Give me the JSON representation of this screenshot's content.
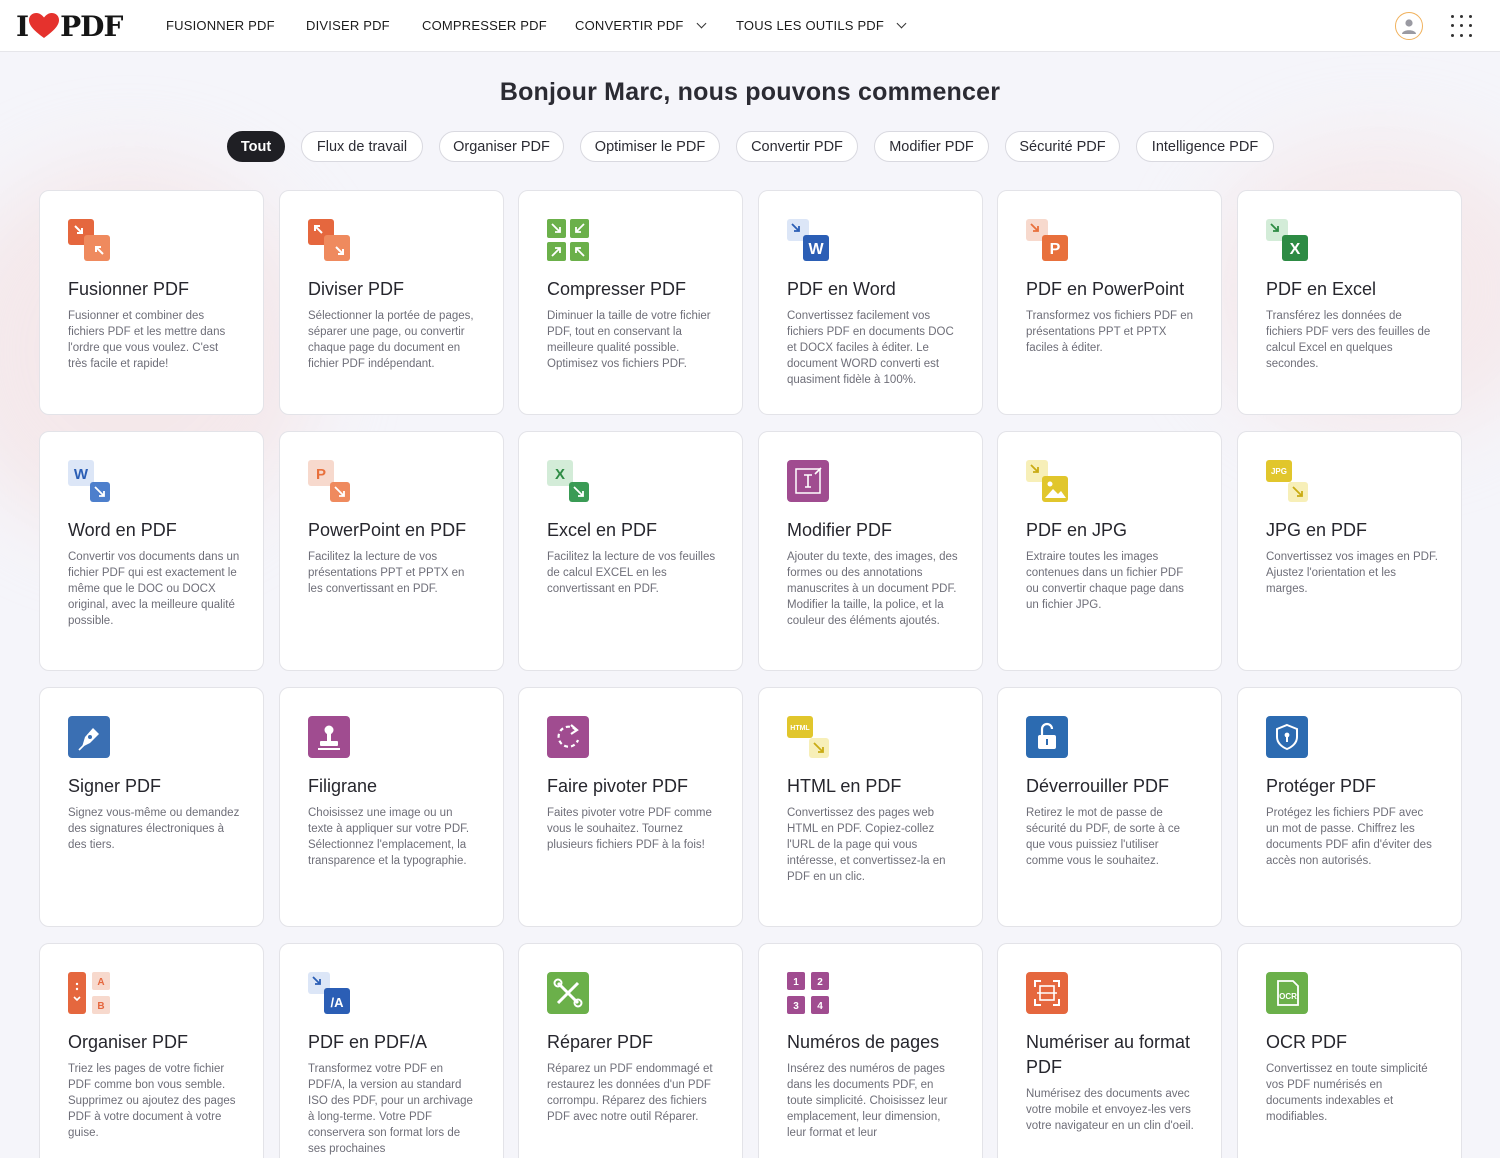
{
  "nav": {
    "logo_left": "I",
    "logo_right": "PDF",
    "items": [
      {
        "label": "FUSIONNER PDF"
      },
      {
        "label": "DIVISER PDF"
      },
      {
        "label": "COMPRESSER PDF"
      },
      {
        "label": "CONVERTIR PDF"
      },
      {
        "label": "TOUS LES OUTILS PDF"
      }
    ]
  },
  "greeting": "Bonjour Marc, nous pouvons commencer",
  "filters": [
    {
      "label": "Tout",
      "active": true
    },
    {
      "label": "Flux de travail"
    },
    {
      "label": "Organiser PDF"
    },
    {
      "label": "Optimiser le PDF"
    },
    {
      "label": "Convertir PDF"
    },
    {
      "label": "Modifier PDF"
    },
    {
      "label": "Sécurité PDF"
    },
    {
      "label": "Intelligence PDF"
    }
  ],
  "colors": {
    "brand_red": "#e5322d",
    "organize": "#e5673e",
    "optimize": "#6bb04a",
    "word": "#2b5eb5",
    "powerpoint": "#e8703c",
    "excel": "#2d8b44",
    "edit": "#a04c90",
    "jpg": "#e1c62c",
    "security": "#2c6bb1",
    "sign": "#3a6fb3"
  },
  "tools": [
    {
      "title": "Fusionner PDF",
      "icon": "merge-icon",
      "desc": "Fusionner et combiner des fichiers PDF et les mettre dans l'ordre que vous voulez. C'est très facile et rapide!"
    },
    {
      "title": "Diviser PDF",
      "icon": "split-icon",
      "desc": "Sélectionner la portée de pages, séparer une page, ou convertir chaque page du document en fichier PDF indépendant."
    },
    {
      "title": "Compresser PDF",
      "icon": "compress-icon",
      "desc": "Diminuer la taille de votre fichier PDF, tout en conservant la meilleure qualité possible. Optimisez vos fichiers PDF."
    },
    {
      "title": "PDF en Word",
      "icon": "pdf-to-word-icon",
      "desc": "Convertissez facilement vos fichiers PDF en documents DOC et DOCX faciles à éditer. Le document WORD converti est quasiment fidèle à 100%.",
      "badge": "W"
    },
    {
      "title": "PDF en PowerPoint",
      "icon": "pdf-to-powerpoint-icon",
      "desc": "Transformez vos fichiers PDF en présentations PPT et PPTX faciles à éditer.",
      "badge": "P"
    },
    {
      "title": "PDF en Excel",
      "icon": "pdf-to-excel-icon",
      "desc": "Transférez les données de fichiers PDF vers des feuilles de calcul Excel en quelques secondes.",
      "badge": "X"
    },
    {
      "title": "Word en PDF",
      "icon": "word-to-pdf-icon",
      "desc": "Convertir vos documents dans un fichier PDF qui est exactement le même que le DOC ou DOCX original, avec la meilleure qualité possible.",
      "badge": "W"
    },
    {
      "title": "PowerPoint en PDF",
      "icon": "powerpoint-to-pdf-icon",
      "desc": "Facilitez la lecture de vos présentations PPT et PPTX en les convertissant en PDF.",
      "badge": "P"
    },
    {
      "title": "Excel en PDF",
      "icon": "excel-to-pdf-icon",
      "desc": "Facilitez la lecture de vos feuilles de calcul EXCEL en les convertissant en PDF.",
      "badge": "X"
    },
    {
      "title": "Modifier PDF",
      "icon": "edit-pdf-icon",
      "desc": "Ajouter du texte, des images, des formes ou des annotations manuscrites à un document PDF. Modifier la taille, la police, et la couleur des éléments ajoutés."
    },
    {
      "title": "PDF en JPG",
      "icon": "pdf-to-jpg-icon",
      "desc": "Extraire toutes les images contenues dans un fichier PDF ou convertir chaque page dans un fichier JPG."
    },
    {
      "title": "JPG en PDF",
      "icon": "jpg-to-pdf-icon",
      "desc": "Convertissez vos images en PDF. Ajustez l'orientation et les marges.",
      "badge": "JPG"
    },
    {
      "title": "Signer PDF",
      "icon": "sign-pdf-icon",
      "desc": "Signez vous-même ou demandez des signatures électroniques à des tiers."
    },
    {
      "title": "Filigrane",
      "icon": "watermark-icon",
      "desc": "Choisissez une image ou un texte à appliquer sur votre PDF. Sélectionnez l'emplacement, la transparence et la typographie."
    },
    {
      "title": "Faire pivoter PDF",
      "icon": "rotate-pdf-icon",
      "desc": "Faites pivoter votre PDF comme vous le souhaitez. Tournez plusieurs fichiers PDF à la fois!"
    },
    {
      "title": "HTML en PDF",
      "icon": "html-to-pdf-icon",
      "desc": "Convertissez des pages web HTML en PDF. Copiez-collez l'URL de la page qui vous intéresse, et convertissez-la en PDF en un clic.",
      "badge": "HTML"
    },
    {
      "title": "Déverrouiller PDF",
      "icon": "unlock-pdf-icon",
      "desc": "Retirez le mot de passe de sécurité du PDF, de sorte à ce que vous puissiez l'utiliser comme vous le souhaitez."
    },
    {
      "title": "Protéger PDF",
      "icon": "protect-pdf-icon",
      "desc": "Protégez les fichiers PDF avec un mot de passe. Chiffrez les documents PDF afin d'éviter des accès non autorisés."
    },
    {
      "title": "Organiser PDF",
      "icon": "organize-pdf-icon",
      "desc": "Triez les pages de votre fichier PDF comme bon vous semble. Supprimez ou ajoutez des pages PDF à votre document à votre guise.",
      "badge_a": "A",
      "badge_b": "B"
    },
    {
      "title": "PDF en PDF/A",
      "icon": "pdf-to-pdfa-icon",
      "desc": "Transformez votre PDF en PDF/A, la version au standard ISO des PDF, pour un archivage à long-terme. Votre PDF conservera son format lors de ses prochaines",
      "badge": "/A"
    },
    {
      "title": "Réparer PDF",
      "icon": "repair-pdf-icon",
      "desc": "Réparez un PDF endommagé et restaurez les données d'un PDF corrompu. Réparez des fichiers PDF avec notre outil Réparer."
    },
    {
      "title": "Numéros de pages",
      "icon": "page-numbers-icon",
      "desc": "Insérez des numéros de pages dans les documents PDF, en toute simplicité. Choisissez leur emplacement, leur dimension, leur format et leur",
      "nums": [
        "1",
        "2",
        "3",
        "4"
      ]
    },
    {
      "title": "Numériser au format PDF",
      "icon": "scan-to-pdf-icon",
      "desc": "Numérisez des documents avec votre mobile et envoyez-les vers votre navigateur en un clin d'oeil."
    },
    {
      "title": "OCR PDF",
      "icon": "ocr-pdf-icon",
      "desc": "Convertissez en toute simplicité vos PDF numérisés en documents indexables et modifiables.",
      "badge": "OCR"
    }
  ]
}
